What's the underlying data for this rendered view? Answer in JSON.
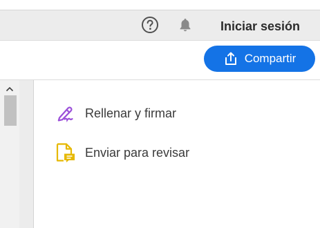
{
  "header": {
    "help_icon": "help-circle-icon",
    "notifications_icon": "bell-icon",
    "signin_label": "Iniciar sesión"
  },
  "toolbar": {
    "share_label": "Compartir",
    "share_icon": "share-upload-icon",
    "share_color": "#1473e6"
  },
  "tools": [
    {
      "label": "Rellenar y firmar",
      "icon": "fill-sign-pen-icon",
      "color": "#9b4fd9"
    },
    {
      "label": "Enviar para revisar",
      "icon": "send-for-review-icon",
      "color": "#e6b800"
    }
  ]
}
